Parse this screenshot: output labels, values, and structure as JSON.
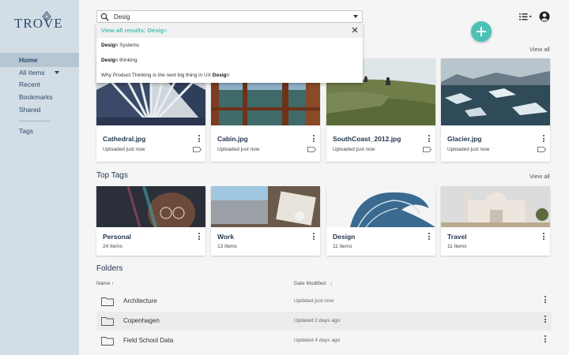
{
  "app": {
    "logo_text": "TROVE"
  },
  "sidebar": {
    "items": [
      {
        "label": "Home"
      },
      {
        "label": "All Items"
      },
      {
        "label": "Recent"
      },
      {
        "label": "Bookmarks"
      },
      {
        "label": "Shared"
      },
      {
        "label": "Tags"
      }
    ]
  },
  "search": {
    "value": "Desig",
    "placeholder": "",
    "view_all_prefix": "View all results: ",
    "view_all_match": "Desig",
    "view_all_rest": "n",
    "suggestions": [
      {
        "bold": "Desig",
        "rest": "n Systems"
      },
      {
        "bold": "Desig",
        "rest": "n thinking"
      },
      {
        "before": "Why Product Thinking is the next big thing in UX ",
        "bold": "Desig",
        "rest": "n"
      }
    ]
  },
  "recent": {
    "view_all": "View all",
    "items": [
      {
        "name": "Cathedral.jpg",
        "status": "Uploaded just now"
      },
      {
        "name": "Cabin.jpg",
        "status": "Uploaded just now"
      },
      {
        "name": "SouthCoast_2012.jpg",
        "status": "Uploaded just now"
      },
      {
        "name": "Glacier.jpg",
        "status": "Uploaded just now"
      }
    ]
  },
  "tags": {
    "title": "Top Tags",
    "view_all": "View all",
    "items": [
      {
        "name": "Personal",
        "count": "24 Items"
      },
      {
        "name": "Work",
        "count": "13 Items"
      },
      {
        "name": "Design",
        "count": "11 Items"
      },
      {
        "name": "Travel",
        "count": "11 Items"
      }
    ]
  },
  "folders": {
    "title": "Folders",
    "col_name": "Name ↑",
    "col_date": "Date Modified",
    "col_date_arrow": "↓",
    "rows": [
      {
        "name": "Architecture",
        "date": "Updated just now"
      },
      {
        "name": "Copenhagen",
        "date": "Updated 2 days ago"
      },
      {
        "name": "Field School Data",
        "date": "Updated 4 days ago"
      }
    ]
  },
  "colors": {
    "accent": "#4bc2b6",
    "sidebar": "#d3dde5",
    "navy": "#253850"
  }
}
